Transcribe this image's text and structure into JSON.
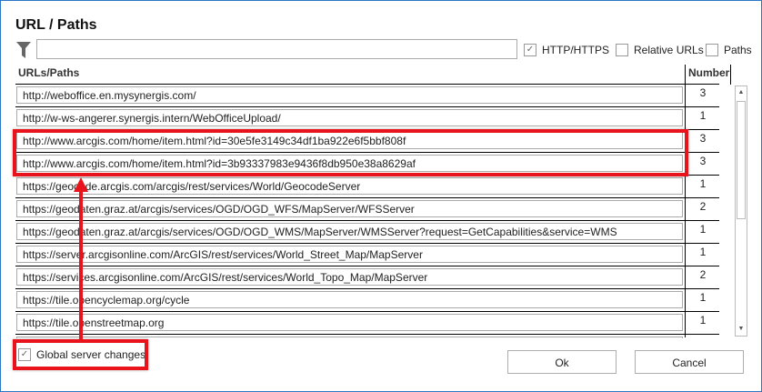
{
  "dialog": {
    "title": "URL / Paths",
    "border_color": "#2b78c6",
    "highlight_color": "#e8131b"
  },
  "filter": {
    "icon": "filter-icon",
    "value": "",
    "placeholder": ""
  },
  "options": [
    {
      "label": "HTTP/HTTPS",
      "checked": true
    },
    {
      "label": "Relative URLs",
      "checked": false
    },
    {
      "label": "Paths",
      "checked": false
    }
  ],
  "table": {
    "headers": {
      "url": "URLs/Paths",
      "number": "Number"
    },
    "rows": [
      {
        "url": "http://weboffice.en.mysynergis.com/",
        "number": "3"
      },
      {
        "url": "http://w-ws-angerer.synergis.intern/WebOfficeUpload/",
        "number": "1"
      },
      {
        "url": "http://www.arcgis.com/home/item.html?id=30e5fe3149c34df1ba922e6f5bbf808f",
        "number": "3"
      },
      {
        "url": "http://www.arcgis.com/home/item.html?id=3b93337983e9436f8db950e38a8629af",
        "number": "3"
      },
      {
        "url": "https://geocode.arcgis.com/arcgis/rest/services/World/GeocodeServer",
        "number": "1"
      },
      {
        "url": "https://geodaten.graz.at/arcgis/services/OGD/OGD_WFS/MapServer/WFSServer",
        "number": "2"
      },
      {
        "url": "https://geodaten.graz.at/arcgis/services/OGD/OGD_WMS/MapServer/WMSServer?request=GetCapabilities&service=WMS",
        "number": "1"
      },
      {
        "url": "https://server.arcgisonline.com/ArcGIS/rest/services/World_Street_Map/MapServer",
        "number": "1"
      },
      {
        "url": "https://services.arcgisonline.com/ArcGIS/rest/services/World_Topo_Map/MapServer",
        "number": "2"
      },
      {
        "url": "https://tile.opencyclemap.org/cycle",
        "number": "1"
      },
      {
        "url": "https://tile.openstreetmap.org",
        "number": "1"
      }
    ]
  },
  "global_changes": {
    "label": "Global server changes",
    "checked": true
  },
  "buttons": {
    "ok": "Ok",
    "cancel": "Cancel"
  }
}
